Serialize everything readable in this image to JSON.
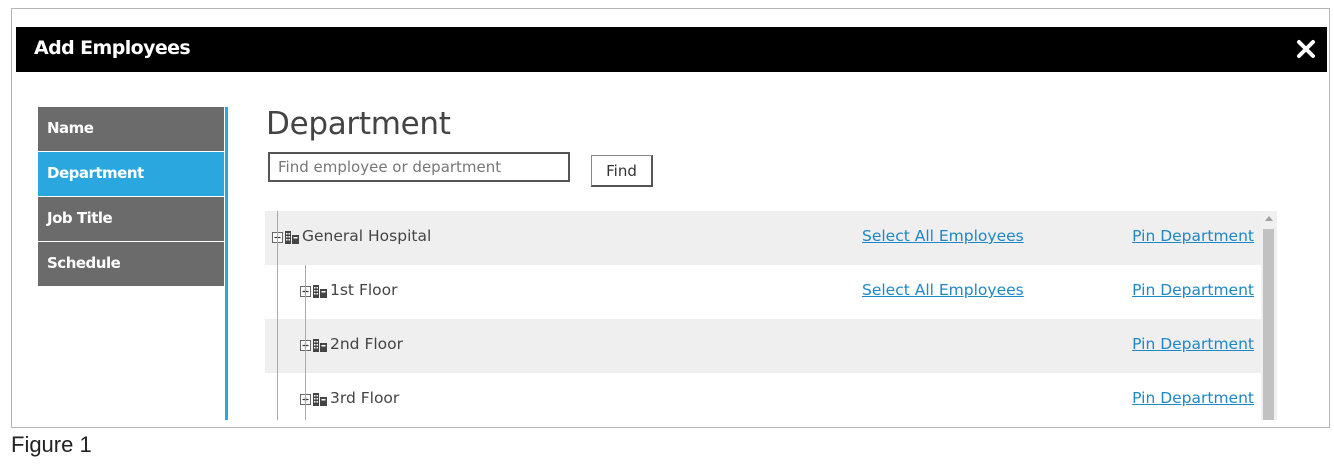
{
  "dialog": {
    "title": "Add Employees",
    "close_icon": "close-icon"
  },
  "nav": {
    "items": [
      {
        "label": "Name",
        "active": false
      },
      {
        "label": "Department",
        "active": true
      },
      {
        "label": "Job Title",
        "active": false
      },
      {
        "label": "Schedule",
        "active": false
      }
    ]
  },
  "content": {
    "heading": "Department",
    "search": {
      "placeholder": "Find employee or department",
      "value": ""
    },
    "find_label": "Find"
  },
  "tree": {
    "rows": [
      {
        "label": "General Hospital",
        "toggle": "collapse",
        "icon": "building-icon",
        "select_all": "Select All Employees",
        "pin": "Pin Department"
      },
      {
        "label": "1st Floor",
        "toggle": "expand",
        "icon": "building-icon",
        "select_all": "Select All Employees",
        "pin": "Pin Department"
      },
      {
        "label": "2nd Floor",
        "toggle": "expand",
        "icon": "building-icon",
        "select_all": "",
        "pin": "Pin Department"
      },
      {
        "label": "3rd Floor",
        "toggle": "expand",
        "icon": "building-icon",
        "select_all": "",
        "pin": "Pin Department"
      }
    ]
  },
  "caption": "Figure 1",
  "colors": {
    "titlebar": "#000000",
    "nav_default": "#6b6b6b",
    "nav_active": "#2aa7df",
    "link": "#1e88c7",
    "row_shade": "#efefef"
  }
}
